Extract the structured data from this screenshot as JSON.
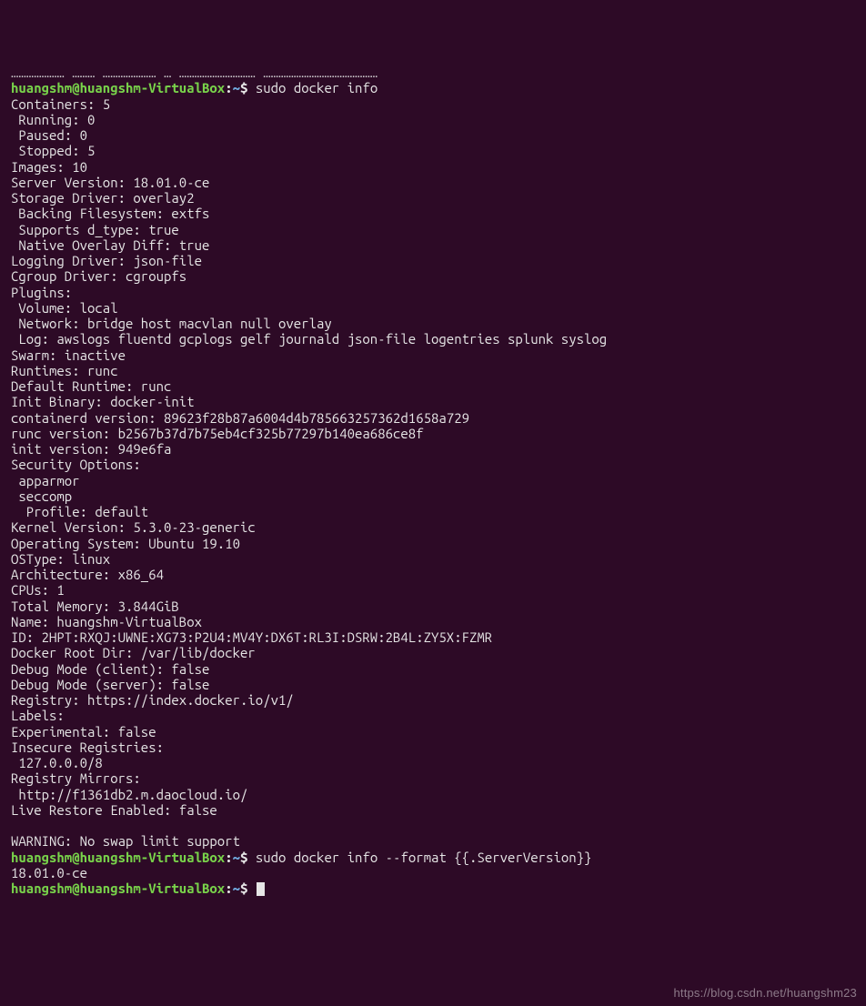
{
  "prompt": {
    "user": "huangshm",
    "at": "@",
    "host": "huangshm-VirtualBox",
    "colon": ":",
    "path": "~",
    "dollar": "$"
  },
  "truncated_top": "………………… ……… ………………… … ………………………… ………………………………………",
  "cmd1": "sudo docker info",
  "info_lines": [
    "Containers: 5",
    " Running: 0",
    " Paused: 0",
    " Stopped: 5",
    "Images: 10",
    "Server Version: 18.01.0-ce",
    "Storage Driver: overlay2",
    " Backing Filesystem: extfs",
    " Supports d_type: true",
    " Native Overlay Diff: true",
    "Logging Driver: json-file",
    "Cgroup Driver: cgroupfs",
    "Plugins:",
    " Volume: local",
    " Network: bridge host macvlan null overlay",
    " Log: awslogs fluentd gcplogs gelf journald json-file logentries splunk syslog",
    "Swarm: inactive",
    "Runtimes: runc",
    "Default Runtime: runc",
    "Init Binary: docker-init",
    "containerd version: 89623f28b87a6004d4b785663257362d1658a729",
    "runc version: b2567b37d7b75eb4cf325b77297b140ea686ce8f",
    "init version: 949e6fa",
    "Security Options:",
    " apparmor",
    " seccomp",
    "  Profile: default",
    "Kernel Version: 5.3.0-23-generic",
    "Operating System: Ubuntu 19.10",
    "OSType: linux",
    "Architecture: x86_64",
    "CPUs: 1",
    "Total Memory: 3.844GiB",
    "Name: huangshm-VirtualBox",
    "ID: 2HPT:RXQJ:UWNE:XG73:P2U4:MV4Y:DX6T:RL3I:DSRW:2B4L:ZY5X:FZMR",
    "Docker Root Dir: /var/lib/docker",
    "Debug Mode (client): false",
    "Debug Mode (server): false",
    "Registry: https://index.docker.io/v1/",
    "Labels:",
    "Experimental: false",
    "Insecure Registries:",
    " 127.0.0.0/8",
    "Registry Mirrors:",
    " http://f1361db2.m.daocloud.io/",
    "Live Restore Enabled: false",
    "",
    "WARNING: No swap limit support"
  ],
  "cmd2": "sudo docker info --format {{.ServerVersion}}",
  "output2": "18.01.0-ce",
  "watermark": "https://blog.csdn.net/huangshm23"
}
